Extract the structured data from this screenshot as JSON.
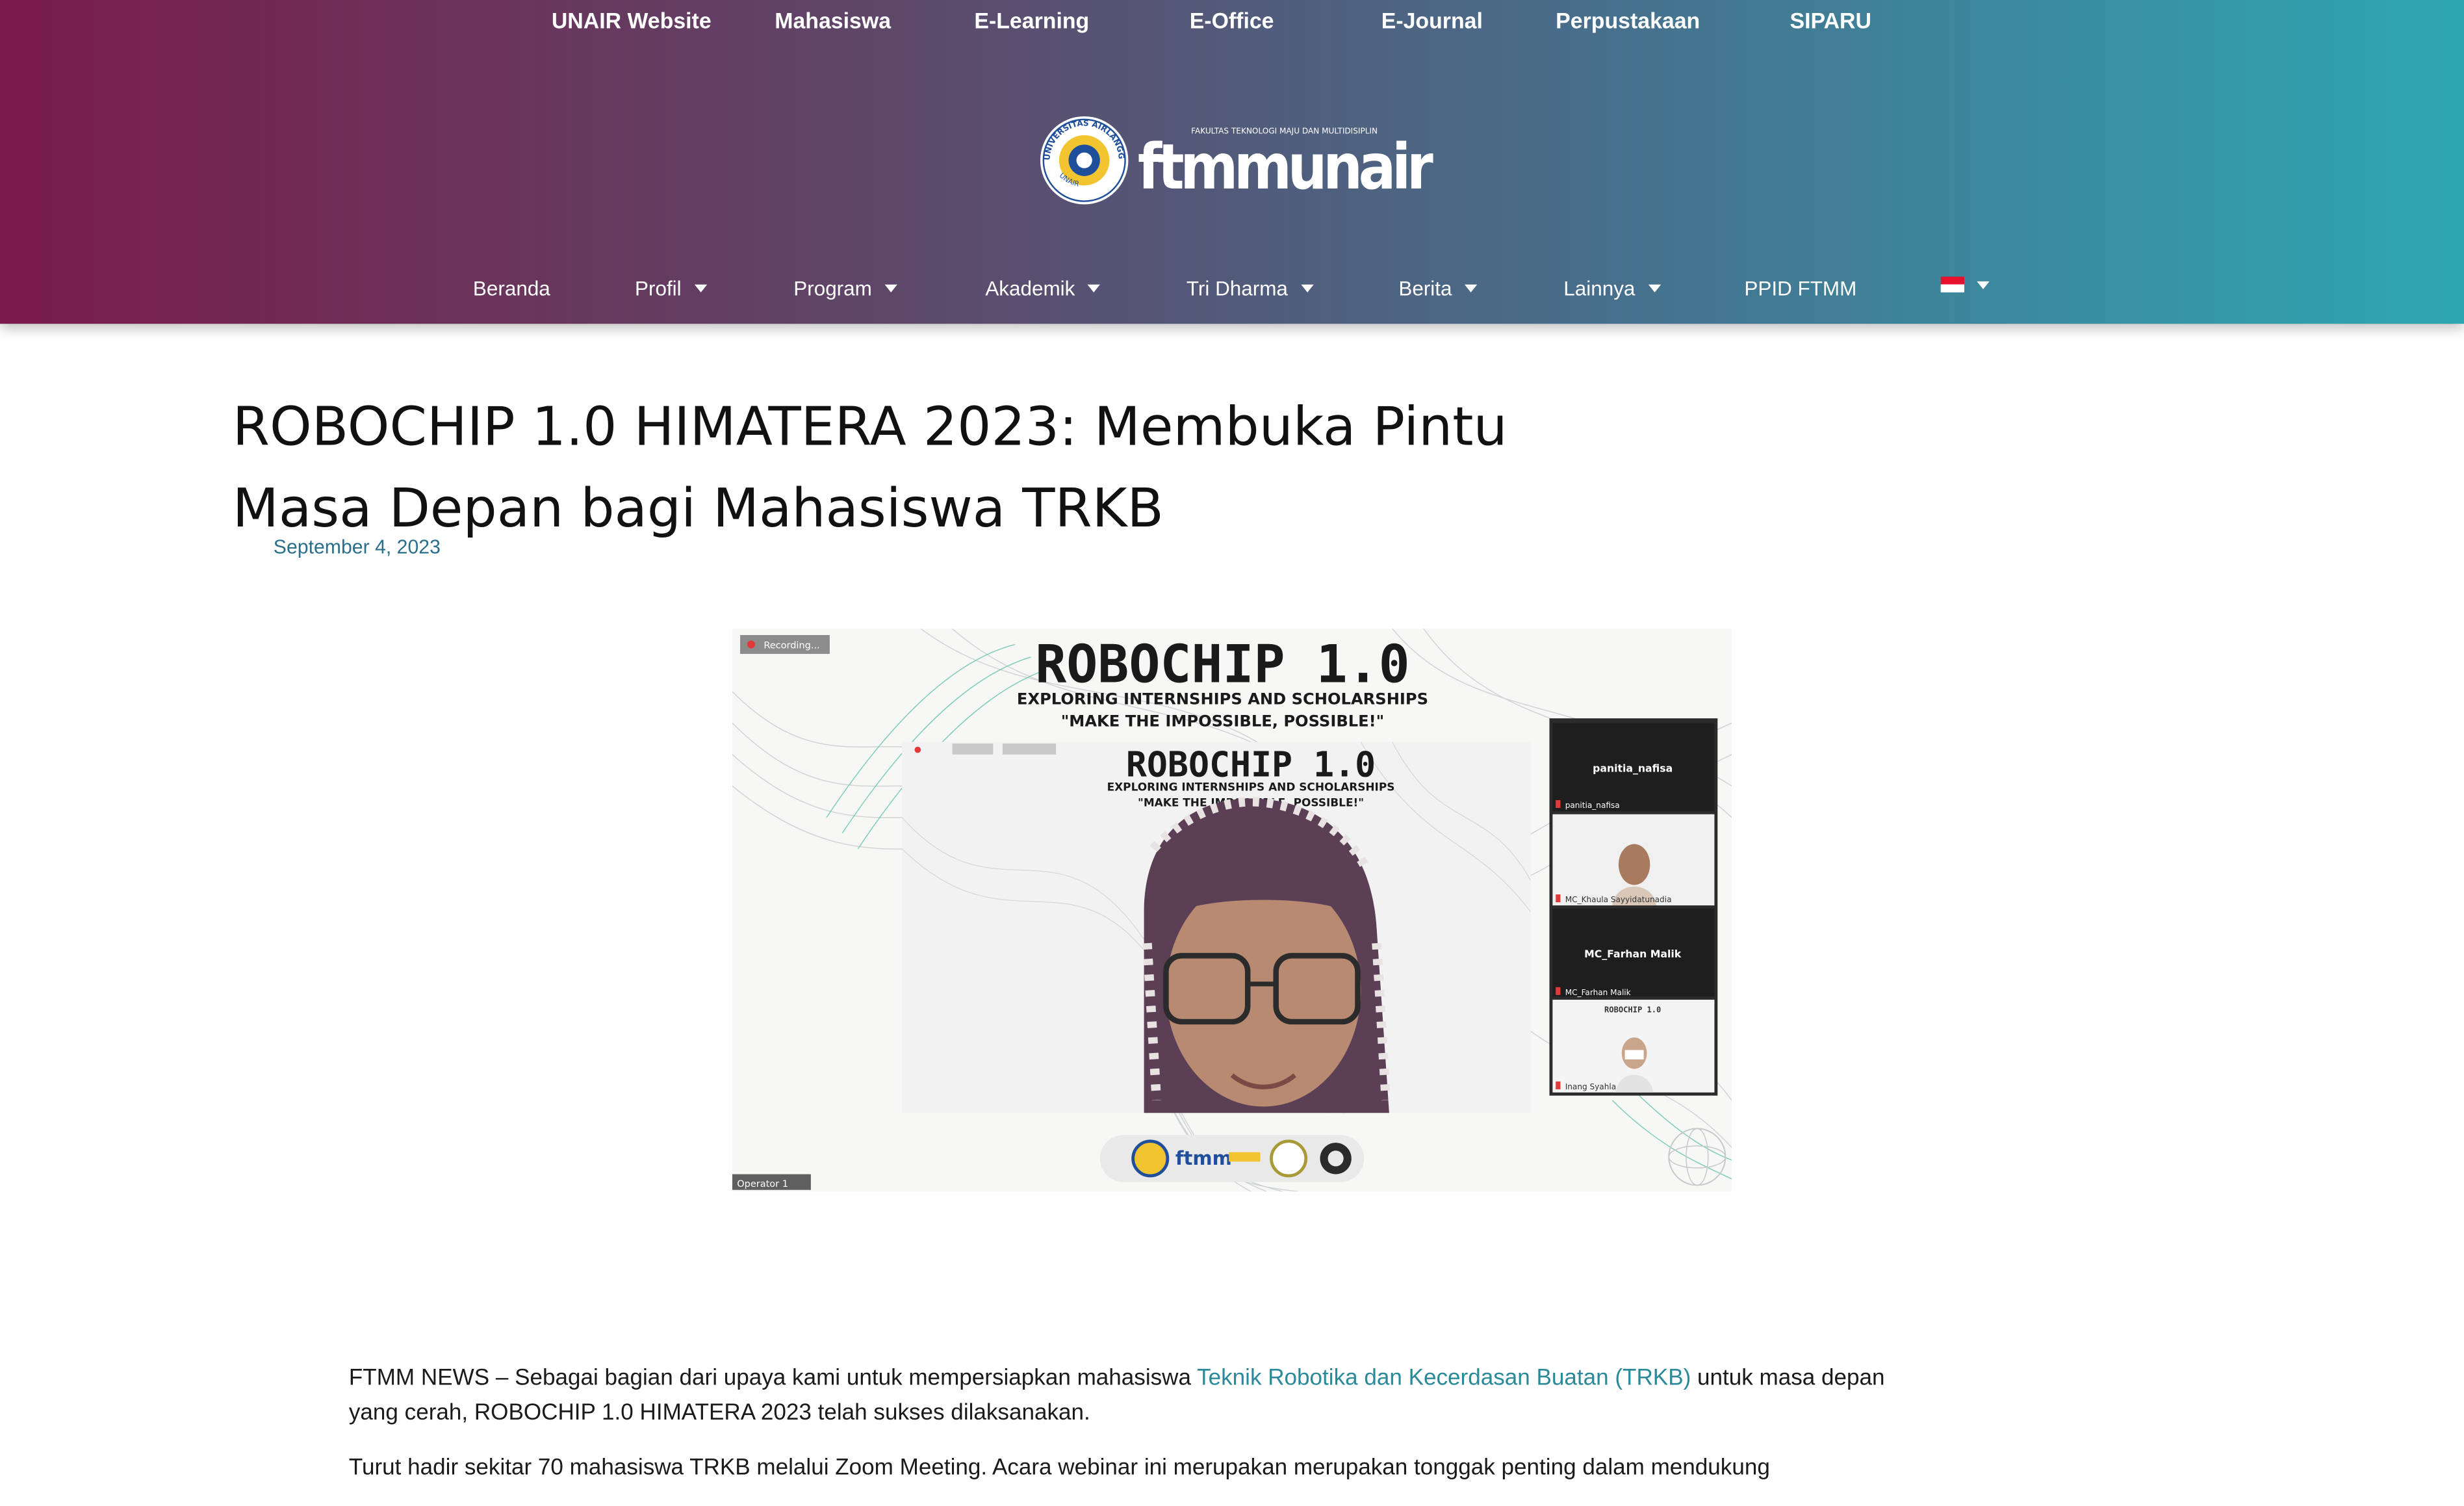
{
  "topnav": [
    {
      "label": "UNAIR Website"
    },
    {
      "label": "Mahasiswa"
    },
    {
      "label": "E-Learning"
    },
    {
      "label": "E-Office"
    },
    {
      "label": "E-Journal"
    },
    {
      "label": "Perpustakaan"
    },
    {
      "label": "SIPARU"
    }
  ],
  "logo": {
    "university_ring_text": "UNIVERSITAS AIRLANGGA",
    "university_ring_bottom": "UNAIR",
    "faculty_tagline": "FAKULTAS TEKNOLOGI MAJU DAN MULTIDISIPLIN",
    "wordmark": "ftmmunair"
  },
  "mainnav": [
    {
      "label": "Beranda",
      "dropdown": false
    },
    {
      "label": "Profil",
      "dropdown": true
    },
    {
      "label": "Program",
      "dropdown": true
    },
    {
      "label": "Akademik",
      "dropdown": true
    },
    {
      "label": "Tri Dharma",
      "dropdown": true
    },
    {
      "label": "Berita",
      "dropdown": true
    },
    {
      "label": "Lainnya",
      "dropdown": true
    },
    {
      "label": "PPID FTMM",
      "dropdown": false
    }
  ],
  "language": {
    "icon": "indonesia-flag-icon"
  },
  "article": {
    "title": "ROBOCHIP 1.0 HIMATERA 2023: Membuka Pintu Masa Depan bagi Mahasiswa TRKB",
    "date": "September 4, 2023",
    "figure": {
      "recording_label": "Recording...",
      "banner_title": "ROBOCHIP 1.0",
      "banner_subtitle": "EXPLORING INTERNSHIPS AND SCHOLARSHIPS",
      "banner_tagline": "\"MAKE THE IMPOSSIBLE, POSSIBLE!\"",
      "participants": [
        {
          "tile_name": "panitia_nafisa",
          "caption": "panitia_nafisa"
        },
        {
          "tile_name": "",
          "caption": "MC_Khaula Sayyidatunadia"
        },
        {
          "tile_name": "MC_Farhan Malik",
          "caption": "MC_Farhan Malik"
        },
        {
          "tile_name": "",
          "caption": "Inang Syahla"
        }
      ],
      "speaker_caption": "Operator 1"
    },
    "para1_prefix": "FTMM NEWS – Sebagai bagian dari upaya kami untuk mempersiapkan mahasiswa ",
    "para1_link": "Teknik Robotika dan Kecerdasan Buatan (TRKB)",
    "para1_suffix": " untuk masa depan yang cerah, ROBOCHIP 1.0 HIMATERA 2023 telah sukses dilaksanakan.",
    "para2": "Turut hadir sekitar 70 mahasiswa TRKB melalui Zoom Meeting. Acara webinar ini merupakan merupakan tonggak penting dalam mendukung"
  },
  "colors": {
    "header_start": "#7a1c4a",
    "header_end": "#2ea7b3",
    "link": "#2a8a9a",
    "date": "#2a6f8c"
  }
}
